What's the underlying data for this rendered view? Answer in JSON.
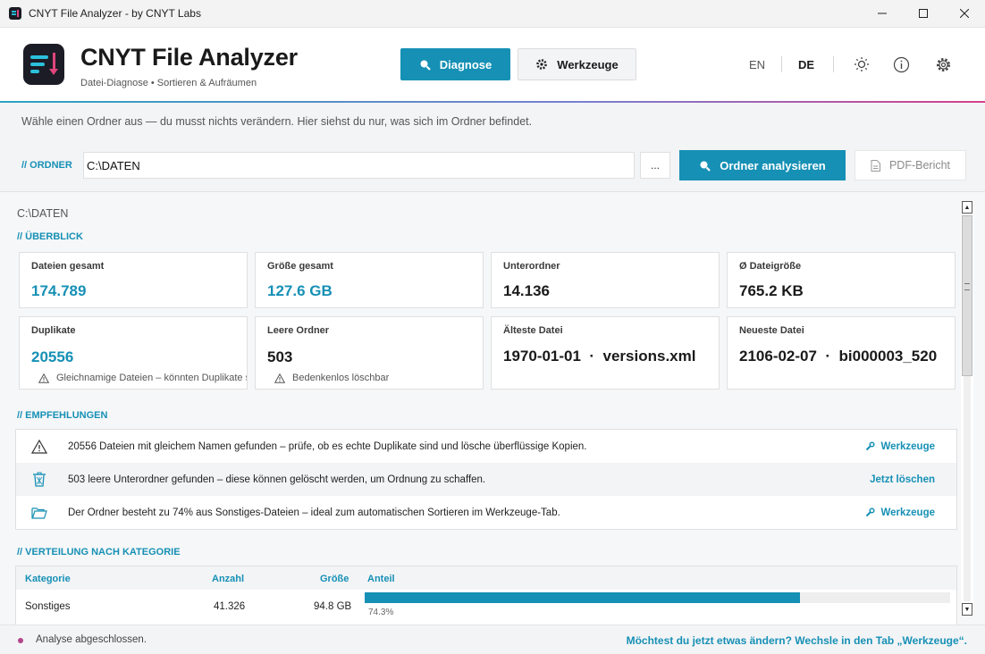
{
  "window": {
    "title": "CNYT File Analyzer - by CNYT Labs"
  },
  "header": {
    "app_name": "CNYT File Analyzer",
    "subtitle": "Datei-Diagnose  •  Sortieren & Aufräumen",
    "tabs": [
      {
        "label": "Diagnose",
        "active": true
      },
      {
        "label": "Werkzeuge",
        "active": false
      }
    ],
    "lang_en": "EN",
    "lang_de": "DE"
  },
  "toolbar": {
    "hint": "Wähle einen Ordner aus — du musst nichts verändern. Hier siehst du nur, was sich im Ordner befindet.",
    "folder_label": "// ORDNER",
    "path_value": "C:\\DATEN",
    "browse_label": "...",
    "analyze_label": "Ordner analysieren",
    "pdf_label": "PDF-Bericht"
  },
  "content": {
    "path": "C:\\DATEN",
    "overview_title": "// ÜBERBLICK",
    "cards": [
      {
        "label": "Dateien gesamt",
        "value": "174.789"
      },
      {
        "label": "Größe gesamt",
        "value": "127.6 GB"
      },
      {
        "label": "Unterordner",
        "value": "14.136"
      },
      {
        "label": "Ø Dateigröße",
        "value": "765.2 KB"
      },
      {
        "label": "Duplikate",
        "value": "20556",
        "note": "Gleichnamige Dateien – könnten Duplikate sein"
      },
      {
        "label": "Leere Ordner",
        "value": "503",
        "note": "Bedenkenlos löschbar"
      },
      {
        "label": "Älteste Datei",
        "value": "1970-01-01  ·  versions.xml"
      },
      {
        "label": "Neueste Datei",
        "value": "2106-02-07  ·  bi000003_520"
      }
    ],
    "recommendations_title": "// EMPFEHLUNGEN",
    "recommendations": [
      {
        "text": "20556 Dateien mit gleichem Namen gefunden – prüfe, ob es echte Duplikate sind und lösche überflüssige Kopien.",
        "action": "Werkzeuge"
      },
      {
        "text": "503 leere Unterordner gefunden – diese können gelöscht werden, um Ordnung zu schaffen.",
        "action": "Jetzt löschen"
      },
      {
        "text": "Der Ordner besteht zu 74% aus Sonstiges-Dateien – ideal zum automatischen Sortieren im Werkzeuge-Tab.",
        "action": "Werkzeuge"
      }
    ],
    "distribution_title": "// VERTEILUNG NACH KATEGORIE",
    "distribution": {
      "headers": {
        "category": "Kategorie",
        "count": "Anzahl",
        "size": "Größe",
        "share": "Anteil"
      },
      "rows": [
        {
          "category": "Sonstiges",
          "count": "41.326",
          "size": "94.8 GB",
          "share_label": "74.3%",
          "share": 0.743
        }
      ]
    }
  },
  "status": {
    "text": "Analyse abgeschlossen.",
    "cta": "Möchtest du jetzt etwas ändern? Wechsle in den Tab „Werkzeuge“."
  },
  "colors": {
    "accent": "#1690b5",
    "brand_pink": "#e0457b",
    "brand_cyan": "#2bc0dc"
  }
}
